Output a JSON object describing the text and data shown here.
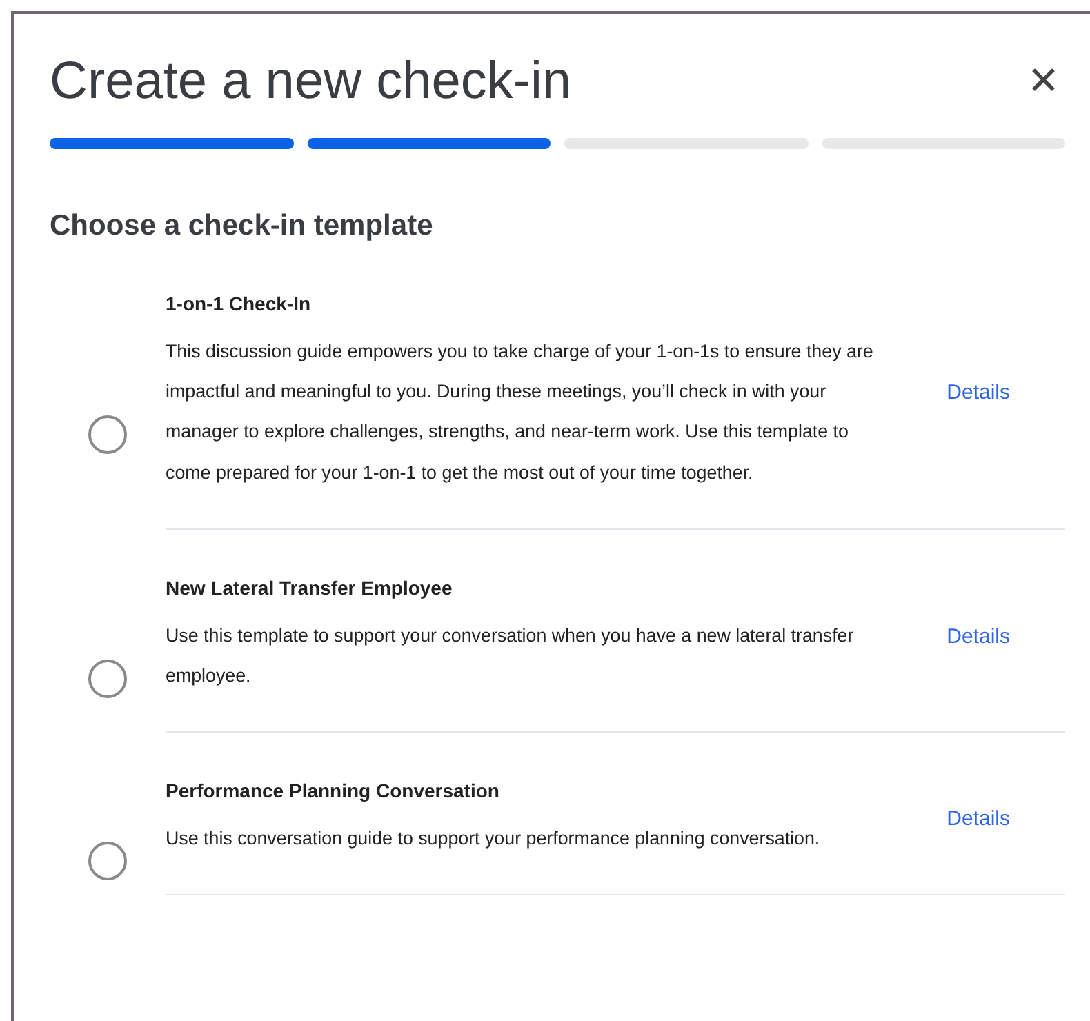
{
  "dialog": {
    "title": "Create a new check-in",
    "close_label": "✕"
  },
  "steps": [
    {
      "done": true
    },
    {
      "done": true
    },
    {
      "done": false
    },
    {
      "done": false
    }
  ],
  "section_title": "Choose a check-in template",
  "templates": [
    {
      "title": "1-on-1 Check-In",
      "description": "This discussion guide empowers you to take charge of your 1-on-1s to ensure they are impactful and meaningful to you. During these meetings, you’ll check in with your manager to explore challenges, strengths, and near-term work. Use this template to come prepared for your 1-on-1 to get the most out of your time together.",
      "link": "Details",
      "selected": false
    },
    {
      "title": "New Lateral Transfer Employee",
      "description": "Use this template to support your conversation when you have a new lateral transfer employee.",
      "link": "Details",
      "selected": false
    },
    {
      "title": "Performance Planning Conversation",
      "description": "Use this conversation guide to support your performance planning conversation.",
      "link": "Details",
      "selected": false
    }
  ]
}
